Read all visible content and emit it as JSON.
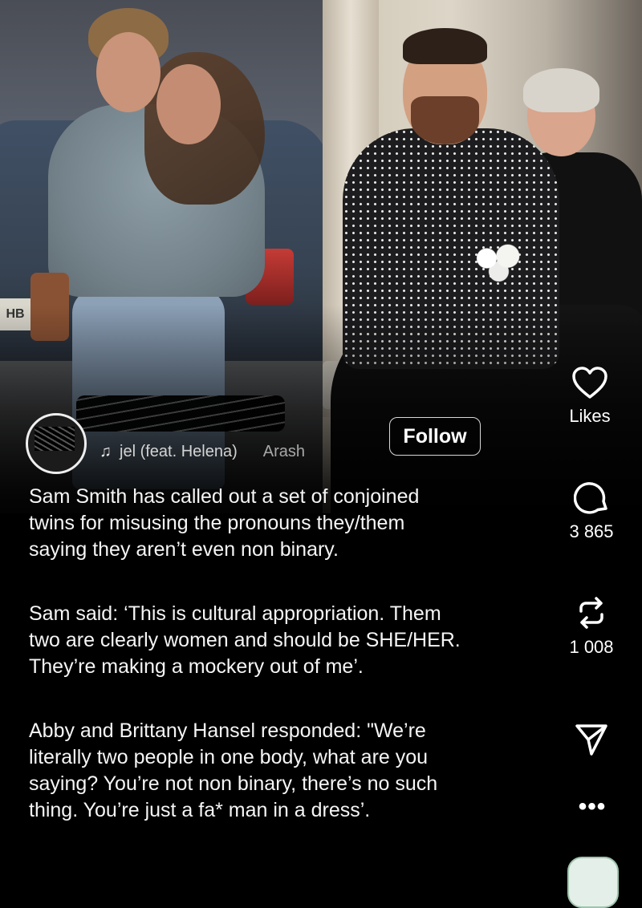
{
  "post": {
    "song": "jel (feat. Helena)",
    "artist": "Arash",
    "follow_label": "Follow",
    "caption": [
      "Sam Smith has called out a set of conjoined\ntwins for misusing the pronouns they/them\nsaying they aren’t even non binary.",
      "Sam said: ‘This is cultural appropriation. Them\ntwo are clearly women and should be SHE/HER.\nThey’re making a mockery out of me’.",
      "Abby and Brittany Hansel responded: \"We’re\nliterally two people in one body, what are you\nsaying?  You’re not non binary, there’s no such\nthing. You’re just a fa* man in a dress’."
    ]
  },
  "photo_left": {
    "plate_text": "HB"
  },
  "actions": {
    "likes_label": "Likes",
    "comments_count": "3 865",
    "reposts_count": "1 008",
    "more_label": "•••"
  },
  "icons": {
    "like": "heart-icon",
    "comment": "comment-bubble-icon",
    "repost": "repost-icon",
    "share": "paper-plane-icon",
    "music": "music-note-icon",
    "more": "more-dots-icon"
  },
  "colors": {
    "background": "#000000",
    "text": "#ffffff",
    "follow_border": "#d8d8d8"
  }
}
